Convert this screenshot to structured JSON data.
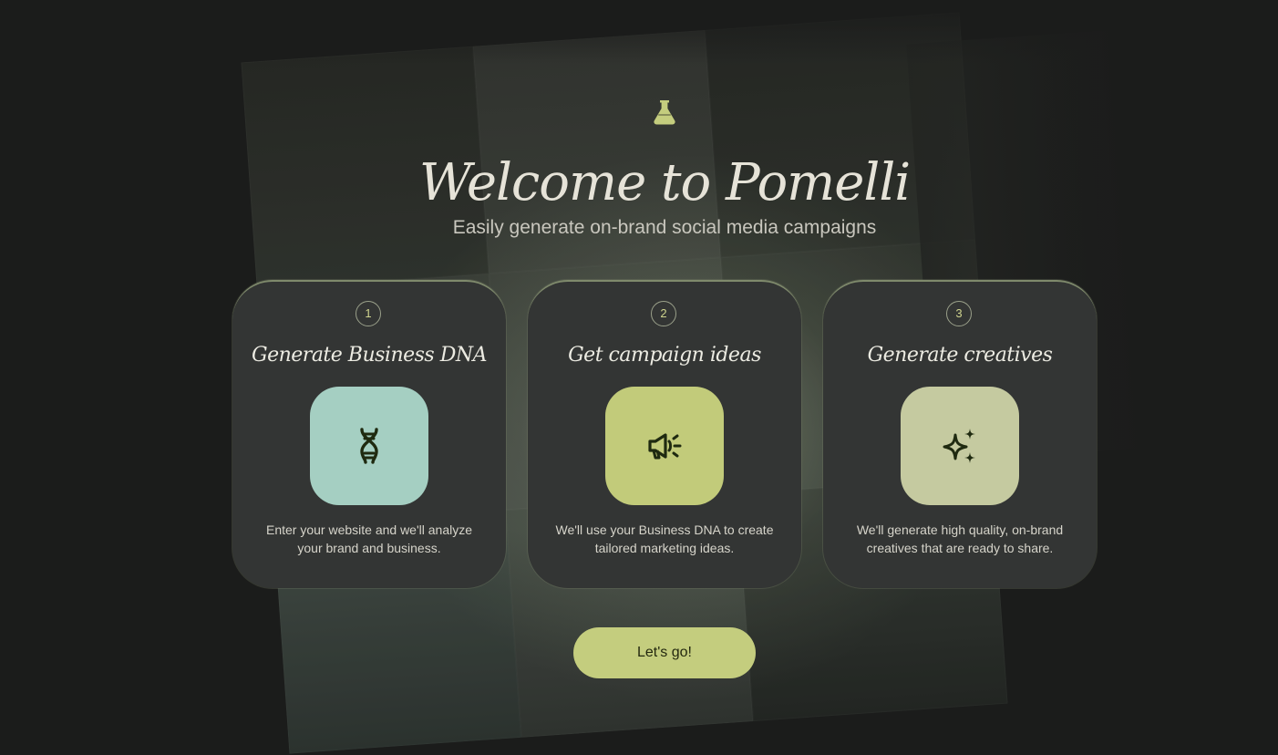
{
  "header": {
    "logo_icon": "flask-icon",
    "title": "Welcome to Pomelli",
    "subtitle": "Easily generate on-brand social media campaigns"
  },
  "steps": [
    {
      "number": "1",
      "title": "Generate Business DNA",
      "icon": "dna-icon",
      "tile_color": "#a5cfc2",
      "description": "Enter your website and we'll analyze your brand and business."
    },
    {
      "number": "2",
      "title": "Get campaign ideas",
      "icon": "megaphone-icon",
      "tile_color": "#c2cb7a",
      "description": "We'll use your Business DNA to create tailored marketing ideas."
    },
    {
      "number": "3",
      "title": "Generate creatives",
      "icon": "sparkles-icon",
      "tile_color": "#c5caa0",
      "description": "We'll generate high quality, on-brand creatives that are ready to share."
    }
  ],
  "cta": {
    "label": "Let's go!"
  },
  "colors": {
    "accent": "#c4cd7e",
    "background": "#1b1c1b",
    "card": "#333534",
    "icon_ink": "#1f2a10"
  }
}
